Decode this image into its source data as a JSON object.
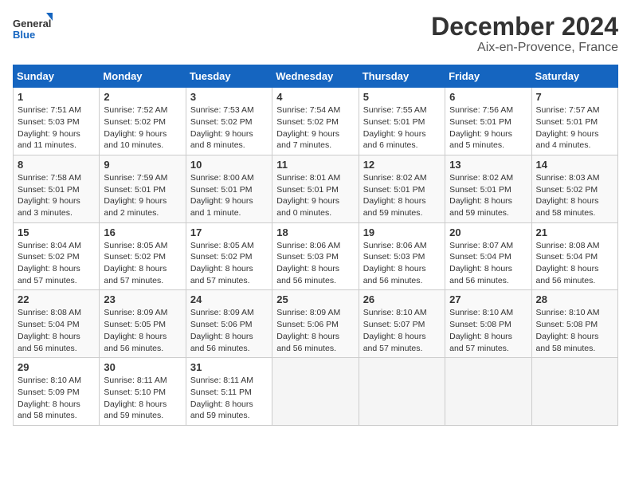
{
  "logo": {
    "general": "General",
    "blue": "Blue"
  },
  "title": "December 2024",
  "subtitle": "Aix-en-Provence, France",
  "weekdays": [
    "Sunday",
    "Monday",
    "Tuesday",
    "Wednesday",
    "Thursday",
    "Friday",
    "Saturday"
  ],
  "weeks": [
    [
      {
        "day": "1",
        "info": "Sunrise: 7:51 AM\nSunset: 5:03 PM\nDaylight: 9 hours and 11 minutes."
      },
      {
        "day": "2",
        "info": "Sunrise: 7:52 AM\nSunset: 5:02 PM\nDaylight: 9 hours and 10 minutes."
      },
      {
        "day": "3",
        "info": "Sunrise: 7:53 AM\nSunset: 5:02 PM\nDaylight: 9 hours and 8 minutes."
      },
      {
        "day": "4",
        "info": "Sunrise: 7:54 AM\nSunset: 5:02 PM\nDaylight: 9 hours and 7 minutes."
      },
      {
        "day": "5",
        "info": "Sunrise: 7:55 AM\nSunset: 5:01 PM\nDaylight: 9 hours and 6 minutes."
      },
      {
        "day": "6",
        "info": "Sunrise: 7:56 AM\nSunset: 5:01 PM\nDaylight: 9 hours and 5 minutes."
      },
      {
        "day": "7",
        "info": "Sunrise: 7:57 AM\nSunset: 5:01 PM\nDaylight: 9 hours and 4 minutes."
      }
    ],
    [
      {
        "day": "8",
        "info": "Sunrise: 7:58 AM\nSunset: 5:01 PM\nDaylight: 9 hours and 3 minutes."
      },
      {
        "day": "9",
        "info": "Sunrise: 7:59 AM\nSunset: 5:01 PM\nDaylight: 9 hours and 2 minutes."
      },
      {
        "day": "10",
        "info": "Sunrise: 8:00 AM\nSunset: 5:01 PM\nDaylight: 9 hours and 1 minute."
      },
      {
        "day": "11",
        "info": "Sunrise: 8:01 AM\nSunset: 5:01 PM\nDaylight: 9 hours and 0 minutes."
      },
      {
        "day": "12",
        "info": "Sunrise: 8:02 AM\nSunset: 5:01 PM\nDaylight: 8 hours and 59 minutes."
      },
      {
        "day": "13",
        "info": "Sunrise: 8:02 AM\nSunset: 5:01 PM\nDaylight: 8 hours and 59 minutes."
      },
      {
        "day": "14",
        "info": "Sunrise: 8:03 AM\nSunset: 5:02 PM\nDaylight: 8 hours and 58 minutes."
      }
    ],
    [
      {
        "day": "15",
        "info": "Sunrise: 8:04 AM\nSunset: 5:02 PM\nDaylight: 8 hours and 57 minutes."
      },
      {
        "day": "16",
        "info": "Sunrise: 8:05 AM\nSunset: 5:02 PM\nDaylight: 8 hours and 57 minutes."
      },
      {
        "day": "17",
        "info": "Sunrise: 8:05 AM\nSunset: 5:02 PM\nDaylight: 8 hours and 57 minutes."
      },
      {
        "day": "18",
        "info": "Sunrise: 8:06 AM\nSunset: 5:03 PM\nDaylight: 8 hours and 56 minutes."
      },
      {
        "day": "19",
        "info": "Sunrise: 8:06 AM\nSunset: 5:03 PM\nDaylight: 8 hours and 56 minutes."
      },
      {
        "day": "20",
        "info": "Sunrise: 8:07 AM\nSunset: 5:04 PM\nDaylight: 8 hours and 56 minutes."
      },
      {
        "day": "21",
        "info": "Sunrise: 8:08 AM\nSunset: 5:04 PM\nDaylight: 8 hours and 56 minutes."
      }
    ],
    [
      {
        "day": "22",
        "info": "Sunrise: 8:08 AM\nSunset: 5:04 PM\nDaylight: 8 hours and 56 minutes."
      },
      {
        "day": "23",
        "info": "Sunrise: 8:09 AM\nSunset: 5:05 PM\nDaylight: 8 hours and 56 minutes."
      },
      {
        "day": "24",
        "info": "Sunrise: 8:09 AM\nSunset: 5:06 PM\nDaylight: 8 hours and 56 minutes."
      },
      {
        "day": "25",
        "info": "Sunrise: 8:09 AM\nSunset: 5:06 PM\nDaylight: 8 hours and 56 minutes."
      },
      {
        "day": "26",
        "info": "Sunrise: 8:10 AM\nSunset: 5:07 PM\nDaylight: 8 hours and 57 minutes."
      },
      {
        "day": "27",
        "info": "Sunrise: 8:10 AM\nSunset: 5:08 PM\nDaylight: 8 hours and 57 minutes."
      },
      {
        "day": "28",
        "info": "Sunrise: 8:10 AM\nSunset: 5:08 PM\nDaylight: 8 hours and 58 minutes."
      }
    ],
    [
      {
        "day": "29",
        "info": "Sunrise: 8:10 AM\nSunset: 5:09 PM\nDaylight: 8 hours and 58 minutes."
      },
      {
        "day": "30",
        "info": "Sunrise: 8:11 AM\nSunset: 5:10 PM\nDaylight: 8 hours and 59 minutes."
      },
      {
        "day": "31",
        "info": "Sunrise: 8:11 AM\nSunset: 5:11 PM\nDaylight: 8 hours and 59 minutes."
      },
      null,
      null,
      null,
      null
    ]
  ]
}
